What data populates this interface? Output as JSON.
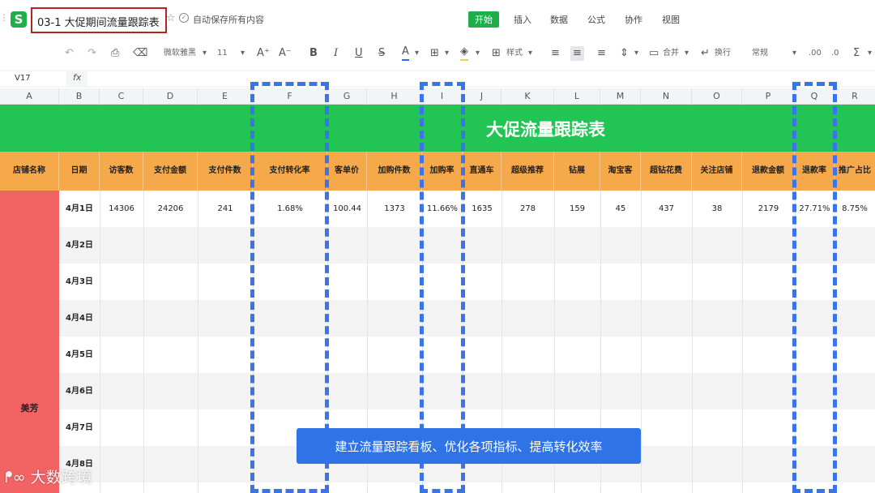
{
  "topbar": {
    "title": "03-1 大促期间流量跟踪表",
    "autosave": "自动保存所有内容",
    "menu": [
      "开始",
      "插入",
      "数据",
      "公式",
      "协作",
      "视图"
    ],
    "active_menu": "开始"
  },
  "toolbar": {
    "undo_icon": "undo-icon",
    "redo_icon": "redo-icon",
    "font_name": "微软雅黑",
    "font_size": "11",
    "font_grow": "A⁺",
    "font_shrink": "A⁻",
    "bold": "B",
    "italic": "I",
    "underline": "U",
    "strike": "S",
    "font_color": "A",
    "style_label": "样式",
    "merge_label": "合并",
    "wrap_label": "换行",
    "number_format": "常规",
    "sum_symbol": "Σ",
    "accent_color": "#1fae4a"
  },
  "formula_bar": {
    "cell_ref": "V17",
    "fx": "fx",
    "value": ""
  },
  "columns": [
    "A",
    "B",
    "C",
    "D",
    "E",
    "F",
    "G",
    "H",
    "I",
    "J",
    "K",
    "L",
    "M",
    "N",
    "O",
    "P",
    "Q",
    "R"
  ],
  "sheet": {
    "title": "大促流量跟踪表",
    "headers": [
      "店铺名称",
      "日期",
      "访客数",
      "支付金额",
      "支付件数",
      "支付转化率",
      "客单价",
      "加购件数",
      "加购率",
      "直通车",
      "超级推荐",
      "钻展",
      "淘宝客",
      "超钻花费",
      "关注店铺",
      "退款金额",
      "退款率",
      "推广占比"
    ],
    "store": "美芳",
    "rows": [
      {
        "date": "4月1日",
        "values": [
          "14306",
          "24206",
          "241",
          "1.68%",
          "100.44",
          "1373",
          "11.66%",
          "1635",
          "278",
          "159",
          "45",
          "437",
          "38",
          "2179",
          "27.71%",
          "8.75%"
        ]
      },
      {
        "date": "4月2日",
        "values": []
      },
      {
        "date": "4月3日",
        "values": []
      },
      {
        "date": "4月4日",
        "values": []
      },
      {
        "date": "4月5日",
        "values": []
      },
      {
        "date": "4月6日",
        "values": []
      },
      {
        "date": "4月7日",
        "values": []
      },
      {
        "date": "4月8日",
        "values": []
      }
    ],
    "colors": {
      "title_bg": "#22c453",
      "header_bg": "#f6a94a",
      "store_bg": "#f26464"
    }
  },
  "overlay": {
    "caption": "建立流量跟踪看板、优化各项指标、提高转化效率",
    "watermark": "大数跨境",
    "highlight_color": "#3a74e8"
  }
}
